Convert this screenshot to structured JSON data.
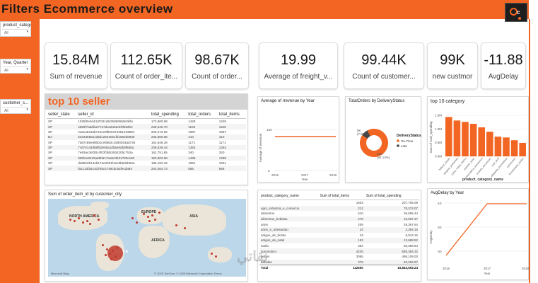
{
  "header": {
    "title": "Filters Ecommerce overview",
    "logo_text": "c"
  },
  "slicers": [
    {
      "label": "product_categor...",
      "value": "All"
    },
    {
      "label": "Year, Quarter",
      "value": "All"
    },
    {
      "label": "customer_s...",
      "value": "All"
    }
  ],
  "kpis": [
    {
      "value": "15.84M",
      "label": "Sum of rrevenue"
    },
    {
      "value": "112.65K",
      "label": "Count of order_ite..."
    },
    {
      "value": "98.67K",
      "label": "Count of order..."
    },
    {
      "value": "19.99",
      "label": "Average of freight_v..."
    },
    {
      "value": "99.44K",
      "label": "Count of customer..."
    },
    {
      "value": "99K",
      "label": "new custmor"
    },
    {
      "value": "-11.88",
      "label": "AvgDelay"
    }
  ],
  "top_seller": {
    "title": "top 10 seller",
    "columns": [
      "seller_state",
      "seller_id",
      "total_spending",
      "total_orders",
      "total_items"
    ],
    "rows": [
      [
        "SP",
        "1025f0e2d44d7041d6cf58b6550e0bfa",
        "172,860.69",
        "1428",
        "1428"
      ],
      [
        "SP",
        "4869f7a5dfa277a7dca6462dcf3b52b2",
        "249,640.70",
        "1106",
        "1156"
      ],
      [
        "SP",
        "4a3ca9315b744ce9f8e9374361493884",
        "200,472.92",
        "1987",
        "1987"
      ],
      [
        "BA",
        "53243585a1d6dc2643021fd1853d8905",
        "235,856.68",
        "410",
        "410"
      ],
      [
        "SP",
        "7a67c85e85bb2ce8582c1590263ad736",
        "162,648.38",
        "1171",
        "1171"
      ],
      [
        "SP",
        "7c67e1448b8f6de06a1d55e6db9f8d6a",
        "239,536.44",
        "1364",
        "1364"
      ],
      [
        "SP",
        "7e93a43ef30c4f03f38b393420bc753a",
        "162,751.85",
        "340",
        "340"
      ],
      [
        "SP",
        "955fee9216a65b617aa5c0531780ce60",
        "160,602.68",
        "1499",
        "1499"
      ],
      [
        "SP",
        "da8622b14eb17ae2831f4ac5b9dab84a",
        "185,192.32",
        "1551",
        "1551"
      ],
      [
        "SP",
        "fa1c13f2614d7b5c4749cbc52fecda94",
        "204,084.73",
        "586",
        "586"
      ]
    ]
  },
  "revenue_by_year": {
    "title": "Average of rrevenue by Year",
    "ylabel": "Average of rrevenue",
    "xlabel": "Year",
    "x_ticks": [
      "2016",
      "2017",
      "2018"
    ],
    "y_ticks": [
      "100",
      "0"
    ]
  },
  "delivery_status": {
    "title": "TotalOrders by DeliveryStatus",
    "legend_title": "DeliveryStatus",
    "slices": [
      {
        "name": "On-Time",
        "label": "92.13%",
        "value": 92.13,
        "color": "#f26522"
      },
      {
        "name": "Late",
        "label": "7.87%",
        "value": 7.87,
        "color": "#444444"
      }
    ],
    "late_prefix": "8K",
    "ontime_prefix": "91K",
    "ontime_pct": "(92.13%)",
    "late_pct": "(7.87%)"
  },
  "top_category": {
    "title": "top 10 category",
    "ylabel": "Sum of total_spending",
    "xlabel": "product_category_name",
    "y_ticks": [
      "1.5M",
      "1.0M",
      "0.5M",
      "0.0M"
    ],
    "categories": [
      "beleza_saude",
      "relogios_presentes",
      "cama_mesa_banho",
      "esporte_lazer",
      "informatica_acessorios",
      "moveis_decoracao",
      "cool_stuff",
      "utilidades_domesticas",
      "automotivo",
      "ferramentas_jardim"
    ],
    "values": [
      1.44,
      1.31,
      1.26,
      1.19,
      1.06,
      0.9,
      0.72,
      0.69,
      0.59,
      0.49
    ]
  },
  "map": {
    "title": "Sum of order_item_id by customer_city",
    "labels": {
      "north_america": "NORTH AMERICA",
      "europe": "EUROPE",
      "asia": "ASIA",
      "africa": "AFRICA",
      "america_s": "AMERICA"
    },
    "footer": "© 2025 TomTom, © 2025 Microsoft Corporation  Terms",
    "brand": "Microsoft Bing"
  },
  "category_table": {
    "columns": [
      "product_category_name",
      "Sum of total_items",
      "Sum of total_spending"
    ],
    "rows": [
      [
        "",
        "1603",
        "207,705.09"
      ],
      [
        "agro_industria_e_comercio",
        "212",
        "78,374.07"
      ],
      [
        "alimentos",
        "510",
        "36,655.44"
      ],
      [
        "alimentos_bebidas",
        "278",
        "19,687.47"
      ],
      [
        "artes",
        "209",
        "28,367.64"
      ],
      [
        "artes_e_artesanato",
        "24",
        "2,394.16"
      ],
      [
        "artigos_de_festas",
        "43",
        "5,913.15"
      ],
      [
        "artigos_de_natal",
        "153",
        "12,688.52"
      ],
      [
        "audio",
        "364",
        "56,398.94"
      ],
      [
        "automotivo",
        "4235",
        "685,384.32"
      ],
      [
        "bebes",
        "3065",
        "486,108.00"
      ],
      [
        "bebidas",
        "379",
        "83,294.97"
      ]
    ],
    "total": [
      "Total",
      "112650",
      "15,843,553.24"
    ]
  },
  "delay_by_year": {
    "title": "AvgDelay by Year",
    "ylabel": "AvgDelay",
    "xlabel": "Year",
    "x_ticks": [
      "2016",
      "2017",
      "2018"
    ],
    "y_ticks": [
      "-10",
      "-20",
      "-30"
    ]
  },
  "watermark": "نقاتي"
}
